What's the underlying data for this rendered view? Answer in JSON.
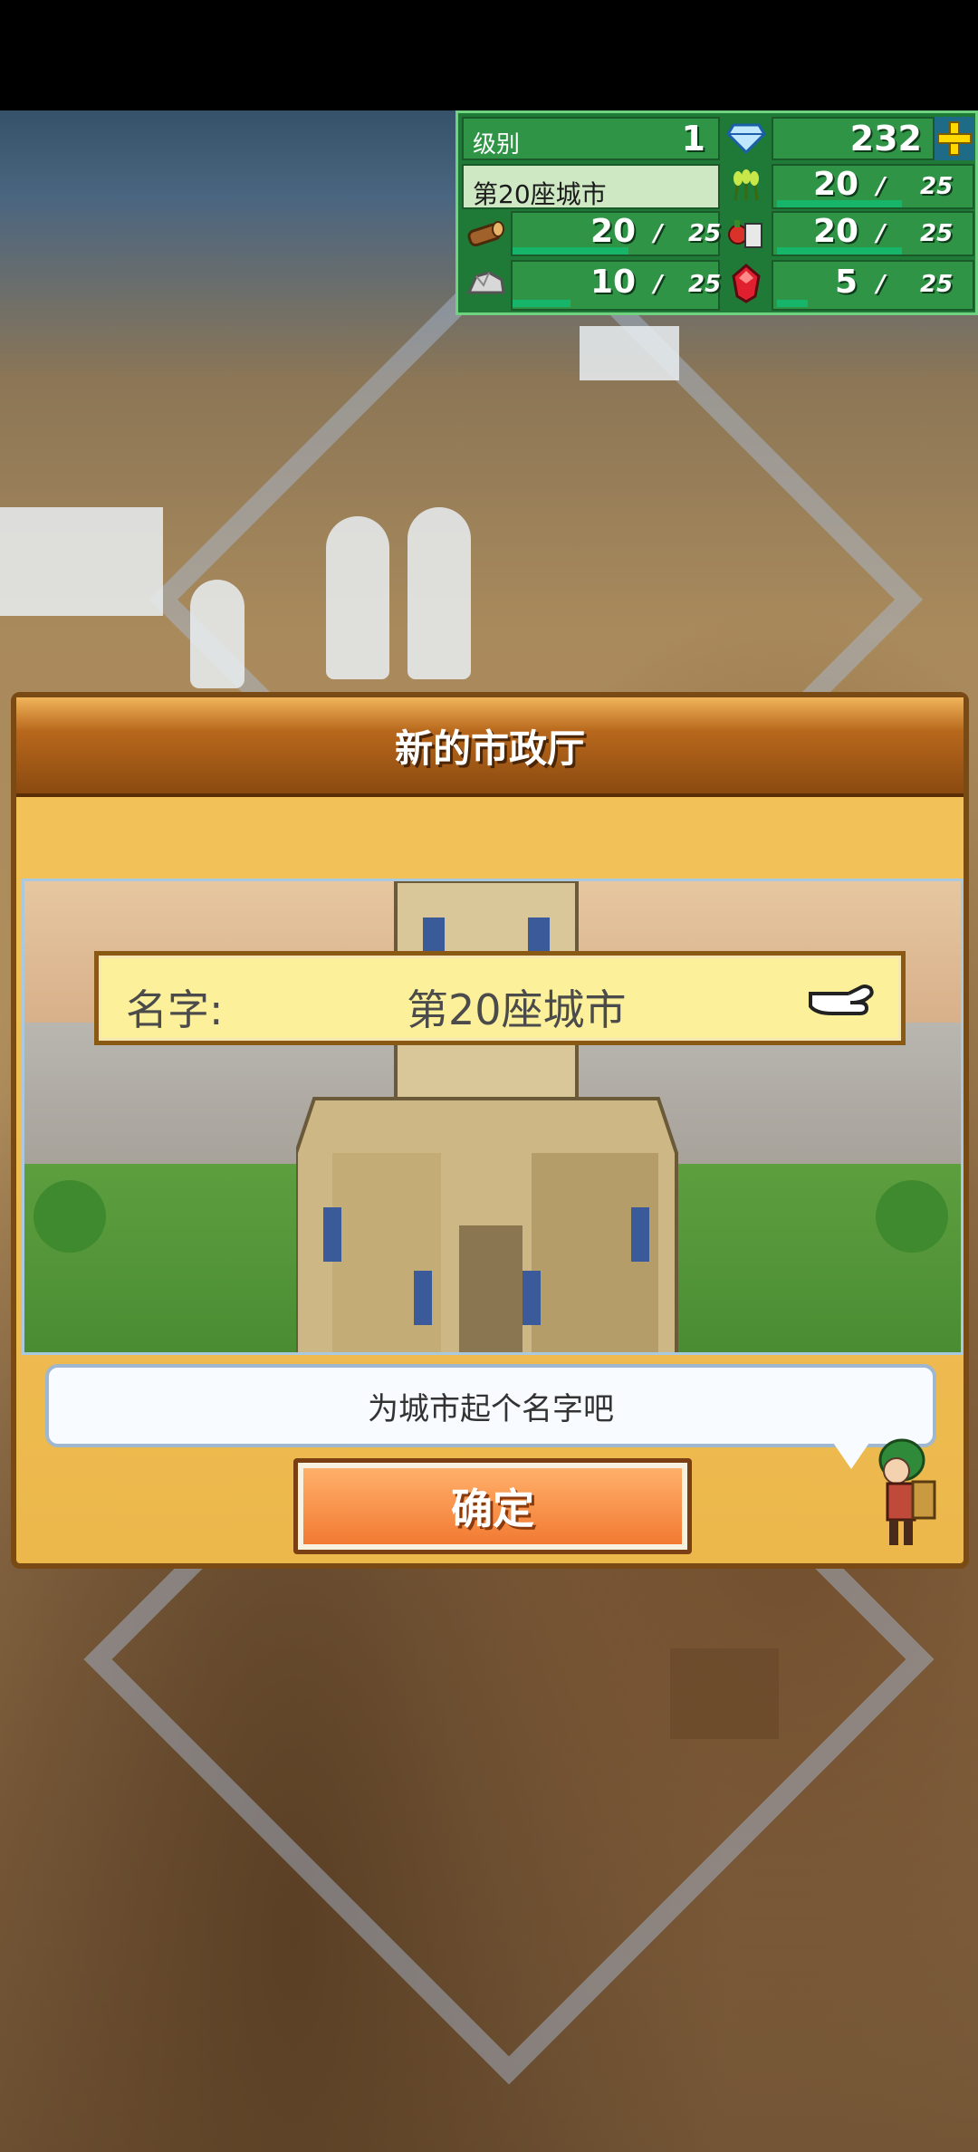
{
  "hud": {
    "level_label": "级别",
    "level_value": "1",
    "gems": "232",
    "plus_icon": "plus-icon",
    "city_name": "第20座城市",
    "resources": [
      {
        "icon": "grain-icon",
        "current": "20",
        "max": "25",
        "fill": 0.8
      },
      {
        "icon": "wood-icon",
        "current": "20",
        "max": "25",
        "fill": 0.8
      },
      {
        "icon": "food-icon",
        "current": "20",
        "max": "25",
        "fill": 0.8
      },
      {
        "icon": "stone-icon",
        "current": "10",
        "max": "25",
        "fill": 0.4
      },
      {
        "icon": "ruby-icon",
        "current": "5",
        "max": "25",
        "fill": 0.2
      }
    ],
    "slash": "/"
  },
  "dialog": {
    "title": "新的市政厅",
    "name_label": "名字:",
    "name_value": "第20座城市",
    "hint": "为城市起个名字吧",
    "confirm": "确定"
  },
  "colors": {
    "hud_bg": "#2f9446",
    "dialog_bg": "#f3c35a",
    "button": "#f27a32"
  }
}
